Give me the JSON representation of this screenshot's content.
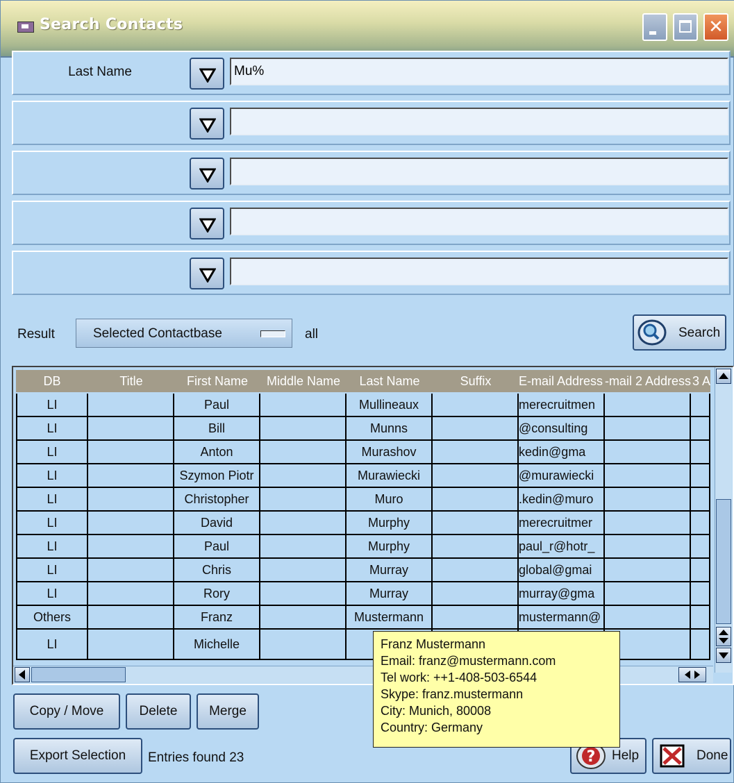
{
  "window": {
    "title": "Search Contacts"
  },
  "criteria": [
    {
      "label": "Last Name",
      "value": "Mu%"
    },
    {
      "label": "",
      "value": ""
    },
    {
      "label": "",
      "value": ""
    },
    {
      "label": "",
      "value": ""
    },
    {
      "label": "",
      "value": ""
    }
  ],
  "result": {
    "label": "Result",
    "select_value": "Selected Contactbase",
    "scope": "all",
    "search_label": "Search"
  },
  "table": {
    "headers": [
      "DB",
      "Title",
      "First Name",
      "Middle Name",
      "Last Name",
      "Suffix",
      "E-mail Address",
      "E-mail 2 Address",
      "E-mail 3 A"
    ],
    "rows": [
      {
        "db": "LI",
        "title": "",
        "first": "Paul",
        "middle": "",
        "last": "Mullineaux",
        "suffix": "",
        "email": "merecruitmen",
        "email2": "",
        "email3": ""
      },
      {
        "db": "LI",
        "title": "",
        "first": "Bill",
        "middle": "",
        "last": "Munns",
        "suffix": "",
        "email": "consulting@",
        "email2": "",
        "email3": ""
      },
      {
        "db": "LI",
        "title": "",
        "first": "Anton",
        "middle": "",
        "last": "Murashov",
        "suffix": "",
        "email": "kedin@gma",
        "email2": "",
        "email3": ""
      },
      {
        "db": "LI",
        "title": "",
        "first": "Szymon Piotr",
        "middle": "",
        "last": "Murawiecki",
        "suffix": "",
        "email": "murawiecki@",
        "email2": "",
        "email3": ""
      },
      {
        "db": "LI",
        "title": "",
        "first": "Christopher",
        "middle": "",
        "last": "Muro",
        "suffix": "",
        "email": "kedin@muro.",
        "email2": "",
        "email3": ""
      },
      {
        "db": "LI",
        "title": "",
        "first": "David",
        "middle": "",
        "last": "Murphy",
        "suffix": "",
        "email": "merecruitmer",
        "email2": "",
        "email3": ""
      },
      {
        "db": "LI",
        "title": "",
        "first": "Paul",
        "middle": "",
        "last": "Murphy",
        "suffix": "",
        "email": "_paul_r@hotr",
        "email2": "",
        "email3": ""
      },
      {
        "db": "LI",
        "title": "",
        "first": "Chris",
        "middle": "",
        "last": "Murray",
        "suffix": "",
        "email": "global@gmai",
        "email2": "",
        "email3": ""
      },
      {
        "db": "LI",
        "title": "",
        "first": "Rory",
        "middle": "",
        "last": "Murray",
        "suffix": "",
        "email": "murray@gma",
        "email2": "",
        "email3": ""
      },
      {
        "db": "Others",
        "title": "",
        "first": "Franz",
        "middle": "",
        "last": "Mustermann",
        "suffix": "",
        "email": "@mustermann",
        "email2": "",
        "email3": ""
      },
      {
        "db": "LI",
        "title": "",
        "first": "Michelle",
        "middle": "",
        "last": "Mu",
        "suffix": "",
        "email": "",
        "email2": "",
        "email3": ""
      }
    ]
  },
  "tooltip": {
    "name": "Franz  Mustermann",
    "email": "Email: franz@mustermann.com",
    "tel": "Tel work: ++1-408-503-6544",
    "skype": "Skype: franz.mustermann",
    "city": "City: Munich, 80008",
    "country": "Country: Germany"
  },
  "buttons": {
    "copy_move": "Copy / Move",
    "delete": "Delete",
    "merge": "Merge",
    "export": "Export Selection",
    "help": "Help",
    "done": "Done"
  },
  "status": {
    "entries": "Entries found 23"
  },
  "icons": {
    "dropdown": "triangle-down-icon",
    "search": "magnifier-icon",
    "help": "question-icon",
    "done": "x-box-icon"
  },
  "colors": {
    "background": "#b9d9f3",
    "header": "#a39c8a",
    "tooltip": "#ffffa8"
  }
}
